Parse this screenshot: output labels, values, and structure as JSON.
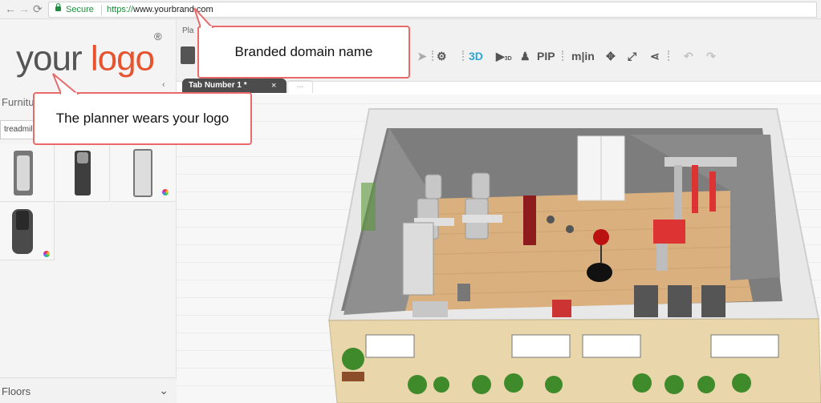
{
  "browser": {
    "secure_label": "Secure",
    "url_protocol": "https://",
    "url_host": "www.yourbrand.com",
    "nav": {
      "back": "←",
      "forward": "→",
      "reload": "⟳"
    }
  },
  "logo": {
    "part1": "your",
    "part2": "logo",
    "reg": "®"
  },
  "sidebar": {
    "section_title": "Furnitu",
    "search_value": "treadmil",
    "floors_label": "Floors"
  },
  "toolbar": {
    "plan_label": "Pla",
    "btn_3d": "3D",
    "btn_pip": "PIP",
    "btn_units": "m|in",
    "play_sub": "3D"
  },
  "tabs": {
    "active_label": "Tab Number 1 *",
    "close": "×",
    "more": "..."
  },
  "callouts": {
    "domain": "Branded domain name",
    "logo": "The planner wears your logo"
  },
  "colors": {
    "callout_border": "#e86a6a",
    "logo_accent": "#e6532e",
    "brand_3d": "#2aa6d6"
  }
}
